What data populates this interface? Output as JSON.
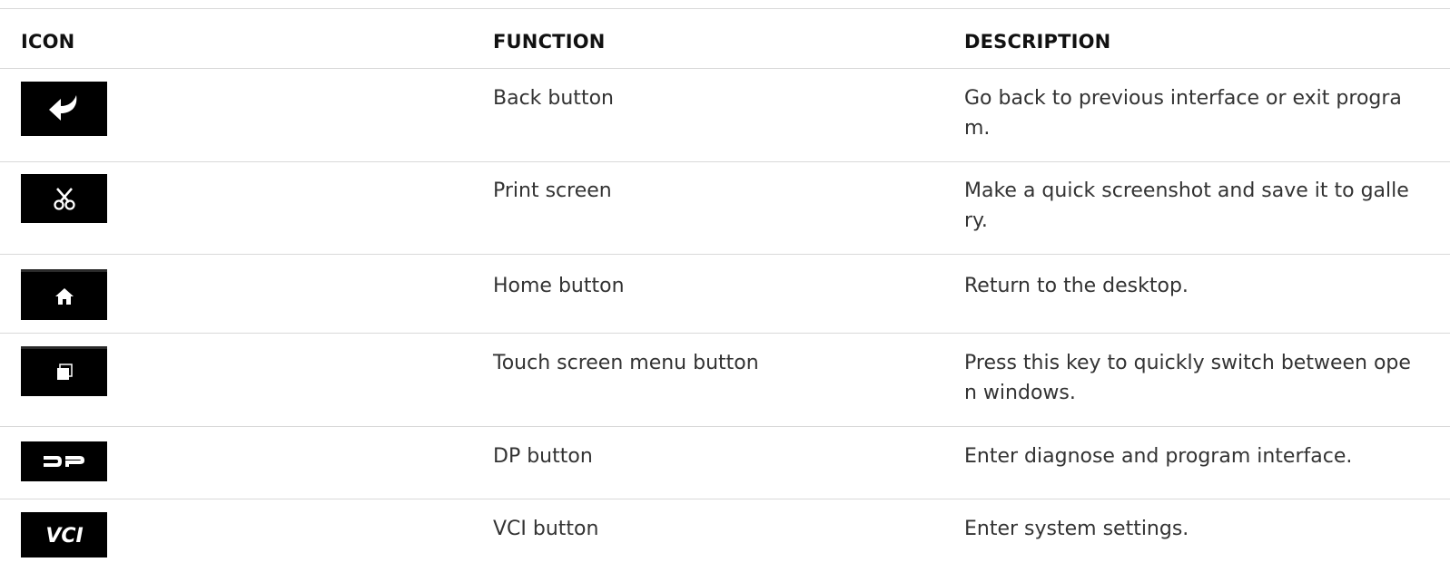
{
  "header": {
    "icon": "ICON",
    "function": "FUNCTION",
    "description": "DESCRIPTION"
  },
  "rows": [
    {
      "icon": "back-arrow-icon",
      "function": "Back button",
      "description": "Go back to previous interface or exit program."
    },
    {
      "icon": "scissors-icon",
      "function": "Print screen",
      "description": "Make a quick screenshot and save it to gallery."
    },
    {
      "icon": "home-icon",
      "function": "Home button",
      "description": "Return to the desktop."
    },
    {
      "icon": "windows-icon",
      "function": "Touch screen menu button",
      "description": "Press this key to quickly switch between open windows."
    },
    {
      "icon": "dp-logo-icon",
      "function": "DP button",
      "description": "Enter diagnose and program interface.",
      "icon_text": "DP"
    },
    {
      "icon": "vci-logo-icon",
      "function": "VCI button",
      "description": "Enter system settings.",
      "icon_text": "VCI"
    }
  ],
  "colors": {
    "icon_background": "#000000",
    "icon_glyph": "#ffffff",
    "border": "#d9d9d9",
    "text": "#333333"
  }
}
